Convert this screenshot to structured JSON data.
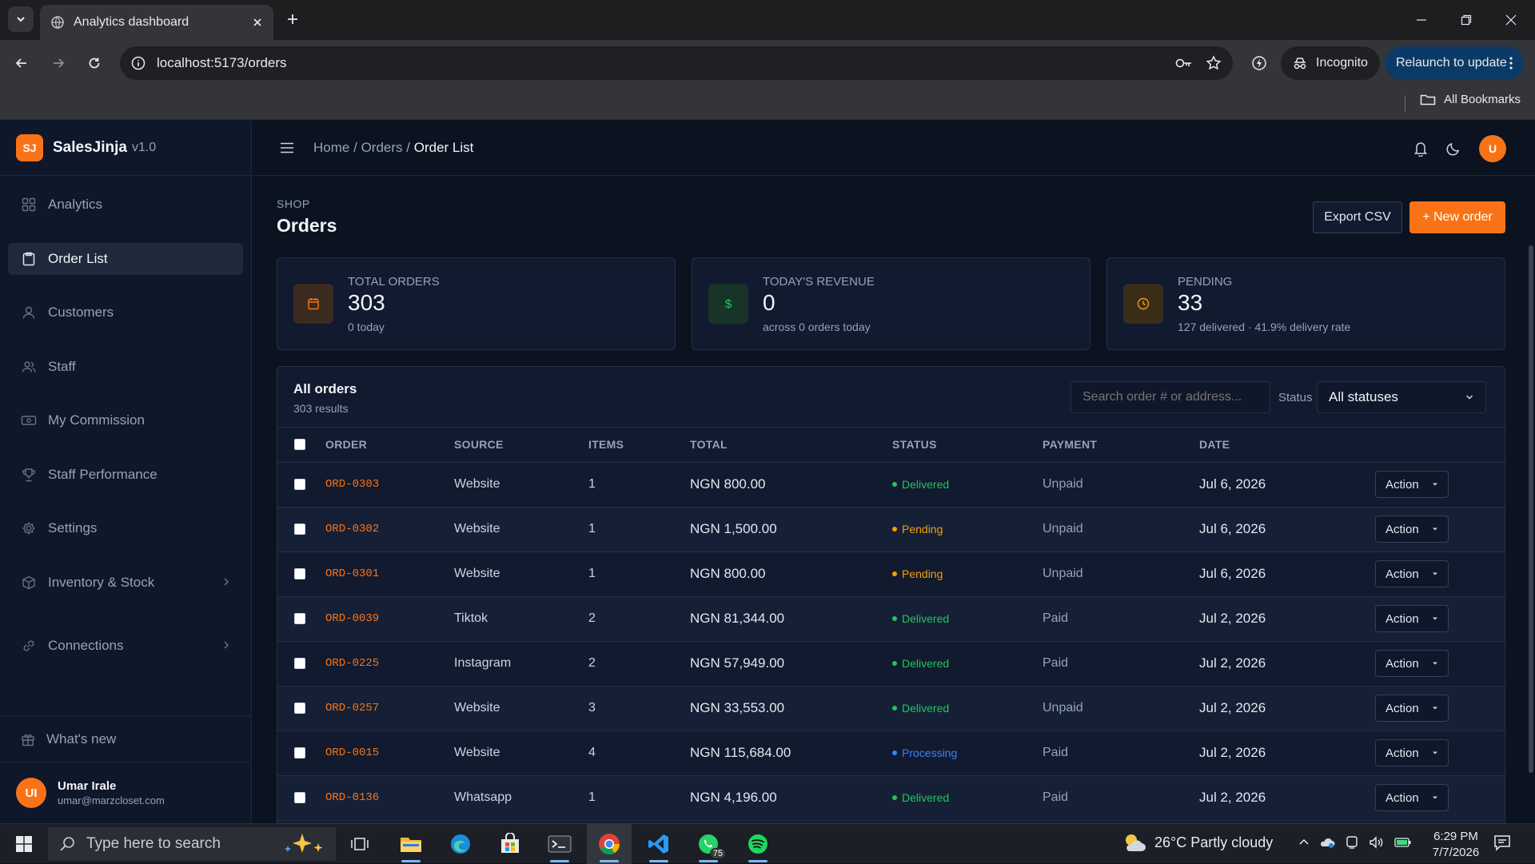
{
  "browser": {
    "tab_title": "Analytics dashboard",
    "url": "localhost:5173/orders",
    "incognito_label": "Incognito",
    "relaunch_label": "Relaunch to update",
    "bookmarks_label": "All Bookmarks"
  },
  "brand": {
    "logo": "SJ",
    "name": "SalesJinja",
    "version": "v1.0"
  },
  "sidebar": {
    "items": [
      {
        "label": "Analytics",
        "icon": "grid-icon"
      },
      {
        "label": "Order List",
        "icon": "clipboard-icon",
        "active": true
      },
      {
        "label": "Customers",
        "icon": "user-icon"
      },
      {
        "label": "Staff",
        "icon": "users-icon"
      },
      {
        "label": "My Commission",
        "icon": "cash-icon"
      },
      {
        "label": "Staff Performance",
        "icon": "trophy-icon"
      },
      {
        "label": "Settings",
        "icon": "gear-icon"
      },
      {
        "label": "Inventory & Stock",
        "icon": "box-icon",
        "expandable": true
      },
      {
        "label": "Connections",
        "icon": "link-icon",
        "expandable": true
      }
    ],
    "whats_new": "What's new",
    "user": {
      "initials": "UI",
      "name": "Umar Irale",
      "email": "umar@marzcloset.com"
    }
  },
  "topbar": {
    "breadcrumb": {
      "home": "Home",
      "sep": "/",
      "section": "Orders",
      "current": "Order List"
    },
    "avatar": "U"
  },
  "page": {
    "eyebrow": "SHOP",
    "title": "Orders",
    "export_label": "Export CSV",
    "new_label": "+ New order"
  },
  "stats": [
    {
      "label": "TOTAL ORDERS",
      "value": "303",
      "sub": "0 today",
      "icon": "calendar-icon",
      "color": "#f97316"
    },
    {
      "label": "TODAY'S REVENUE",
      "value": "0",
      "sub": "across 0 orders today",
      "icon": "dollar-icon",
      "color": "#22c55e"
    },
    {
      "label": "PENDING",
      "value": "33",
      "sub": "127 delivered · 41.9% delivery rate",
      "icon": "clock-icon",
      "color": "#f59e0b"
    }
  ],
  "orders": {
    "title": "All orders",
    "count": "303 results",
    "search_placeholder": "Search order # or address...",
    "status_label": "Status",
    "status_selected": "All statuses",
    "columns": [
      "ORDER",
      "SOURCE",
      "ITEMS",
      "TOTAL",
      "STATUS",
      "PAYMENT",
      "DATE"
    ],
    "action_label": "Action",
    "rows": [
      {
        "order": "ORD-0303",
        "source": "Website",
        "items": "1",
        "total": "NGN 800.00",
        "status": "Delivered",
        "payment": "Unpaid",
        "date": "Jul 6, 2026"
      },
      {
        "order": "ORD-0302",
        "source": "Website",
        "items": "1",
        "total": "NGN 1,500.00",
        "status": "Pending",
        "payment": "Unpaid",
        "date": "Jul 6, 2026"
      },
      {
        "order": "ORD-0301",
        "source": "Website",
        "items": "1",
        "total": "NGN 800.00",
        "status": "Pending",
        "payment": "Unpaid",
        "date": "Jul 6, 2026"
      },
      {
        "order": "ORD-0039",
        "source": "Tiktok",
        "items": "2",
        "total": "NGN 81,344.00",
        "status": "Delivered",
        "payment": "Paid",
        "date": "Jul 2, 2026"
      },
      {
        "order": "ORD-0225",
        "source": "Instagram",
        "items": "2",
        "total": "NGN 57,949.00",
        "status": "Delivered",
        "payment": "Paid",
        "date": "Jul 2, 2026"
      },
      {
        "order": "ORD-0257",
        "source": "Website",
        "items": "3",
        "total": "NGN 33,553.00",
        "status": "Delivered",
        "payment": "Unpaid",
        "date": "Jul 2, 2026"
      },
      {
        "order": "ORD-0015",
        "source": "Website",
        "items": "4",
        "total": "NGN 115,684.00",
        "status": "Processing",
        "payment": "Paid",
        "date": "Jul 2, 2026"
      },
      {
        "order": "ORD-0136",
        "source": "Whatsapp",
        "items": "1",
        "total": "NGN 4,196.00",
        "status": "Delivered",
        "payment": "Paid",
        "date": "Jul 2, 2026"
      }
    ],
    "status_colors": {
      "Delivered": "#22c55e",
      "Pending": "#f59e0b",
      "Processing": "#3b82f6"
    }
  },
  "taskbar": {
    "search_placeholder": "Type here to search",
    "whatsapp_badge": "75",
    "weather": "26°C  Partly cloudy",
    "time": "6:29 PM",
    "date": "7/7/2026"
  }
}
